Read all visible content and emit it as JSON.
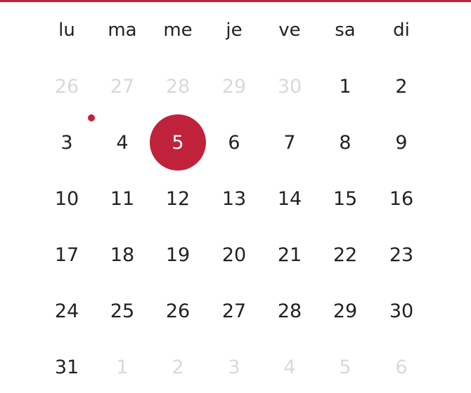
{
  "colors": {
    "accent": "#c0223b",
    "text": "#222222",
    "muted": "#d9d9d9"
  },
  "weekdays": [
    "lu",
    "ma",
    "me",
    "je",
    "ve",
    "sa",
    "di"
  ],
  "weeks": [
    [
      {
        "label": "26",
        "outside": true
      },
      {
        "label": "27",
        "outside": true
      },
      {
        "label": "28",
        "outside": true
      },
      {
        "label": "29",
        "outside": true
      },
      {
        "label": "30",
        "outside": true
      },
      {
        "label": "1",
        "outside": false
      },
      {
        "label": "2",
        "outside": false
      }
    ],
    [
      {
        "label": "3",
        "outside": false,
        "event": true
      },
      {
        "label": "4",
        "outside": false
      },
      {
        "label": "5",
        "outside": false,
        "selected": true
      },
      {
        "label": "6",
        "outside": false
      },
      {
        "label": "7",
        "outside": false
      },
      {
        "label": "8",
        "outside": false
      },
      {
        "label": "9",
        "outside": false
      }
    ],
    [
      {
        "label": "10",
        "outside": false
      },
      {
        "label": "11",
        "outside": false
      },
      {
        "label": "12",
        "outside": false
      },
      {
        "label": "13",
        "outside": false
      },
      {
        "label": "14",
        "outside": false
      },
      {
        "label": "15",
        "outside": false
      },
      {
        "label": "16",
        "outside": false
      }
    ],
    [
      {
        "label": "17",
        "outside": false
      },
      {
        "label": "18",
        "outside": false
      },
      {
        "label": "19",
        "outside": false
      },
      {
        "label": "20",
        "outside": false
      },
      {
        "label": "21",
        "outside": false
      },
      {
        "label": "22",
        "outside": false
      },
      {
        "label": "23",
        "outside": false
      }
    ],
    [
      {
        "label": "24",
        "outside": false
      },
      {
        "label": "25",
        "outside": false
      },
      {
        "label": "26",
        "outside": false
      },
      {
        "label": "27",
        "outside": false
      },
      {
        "label": "28",
        "outside": false
      },
      {
        "label": "29",
        "outside": false
      },
      {
        "label": "30",
        "outside": false
      }
    ],
    [
      {
        "label": "31",
        "outside": false
      },
      {
        "label": "1",
        "outside": true
      },
      {
        "label": "2",
        "outside": true
      },
      {
        "label": "3",
        "outside": true
      },
      {
        "label": "4",
        "outside": true
      },
      {
        "label": "5",
        "outside": true
      },
      {
        "label": "6",
        "outside": true
      }
    ]
  ]
}
